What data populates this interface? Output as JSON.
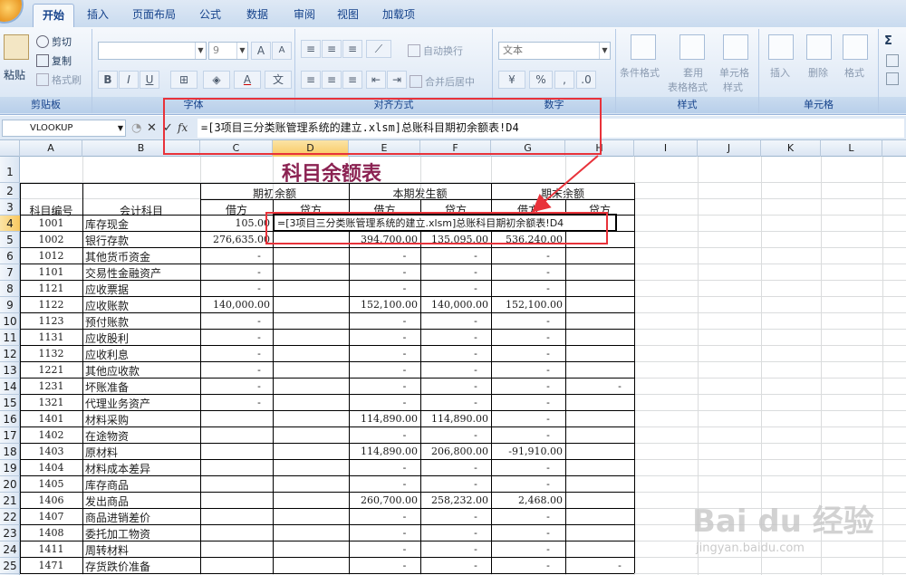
{
  "ribbon_tabs": [
    "开始",
    "插入",
    "页面布局",
    "公式",
    "数据",
    "审阅",
    "视图",
    "加载项"
  ],
  "clipboard": {
    "paste": "粘贴",
    "cut": "剪切",
    "copy": "复制",
    "format_painter": "格式刷",
    "label": "剪贴板"
  },
  "font": {
    "name": "",
    "size": "9",
    "grow": "A",
    "shrink": "A",
    "bold": "B",
    "italic": "I",
    "underline": "U",
    "font_color": "A",
    "phonetic": "文",
    "label": "字体"
  },
  "alignment": {
    "wrap_text": "自动换行",
    "merge_center": "合并后居中",
    "label": "对齐方式"
  },
  "number": {
    "format": "文本",
    "percent": "%",
    "comma": ",",
    "label": "数字"
  },
  "styles": {
    "conditional": "条件格式",
    "table_format_1": "套用",
    "table_format_2": "表格格式",
    "cell_styles_1": "单元格",
    "cell_styles_2": "样式",
    "label": "样式"
  },
  "cells": {
    "insert": "插入",
    "delete": "删除",
    "format": "格式",
    "label": "单元格"
  },
  "editing": {
    "sigma": "Σ"
  },
  "formula_bar": {
    "name_box": "VLOOKUP",
    "fx": "fx",
    "content": "=[3项目三分类账管理系统的建立.xlsm]总账科目期初余额表!D4"
  },
  "columns": [
    "A",
    "B",
    "C",
    "D",
    "E",
    "F",
    "G",
    "H",
    "I",
    "J",
    "K",
    "L"
  ],
  "sheet": {
    "title": "科目余额表",
    "hdr_code": "科目编号",
    "hdr_account": "会计科目",
    "grp_opening": "期初余额",
    "grp_current": "本期发生额",
    "grp_closing": "期末余额",
    "debit": "借方",
    "credit": "贷方",
    "editing_formula": "=[3项目三分类账管理系统的建立.xlsm]总账科目期初余额表!D4",
    "rows": [
      {
        "n": "4",
        "code": "1001",
        "name": "库存现金",
        "c": "105.00",
        "e": "",
        "f": "",
        "g": "",
        "h": ""
      },
      {
        "n": "5",
        "code": "1002",
        "name": "银行存款",
        "c": "276,635.00",
        "e": "394,700.00",
        "f": "135,095.00",
        "g": "536,240.00",
        "h": ""
      },
      {
        "n": "6",
        "code": "1012",
        "name": "其他货币资金",
        "c": "-",
        "e": "-",
        "f": "-",
        "g": "-",
        "h": ""
      },
      {
        "n": "7",
        "code": "1101",
        "name": "交易性金融资产",
        "c": "-",
        "e": "-",
        "f": "-",
        "g": "-",
        "h": ""
      },
      {
        "n": "8",
        "code": "1121",
        "name": "应收票据",
        "c": "-",
        "e": "-",
        "f": "-",
        "g": "-",
        "h": ""
      },
      {
        "n": "9",
        "code": "1122",
        "name": "应收账款",
        "c": "140,000.00",
        "e": "152,100.00",
        "f": "140,000.00",
        "g": "152,100.00",
        "h": ""
      },
      {
        "n": "10",
        "code": "1123",
        "name": "预付账款",
        "c": "-",
        "e": "-",
        "f": "-",
        "g": "-",
        "h": ""
      },
      {
        "n": "11",
        "code": "1131",
        "name": "应收股利",
        "c": "-",
        "e": "-",
        "f": "-",
        "g": "-",
        "h": ""
      },
      {
        "n": "12",
        "code": "1132",
        "name": "应收利息",
        "c": "-",
        "e": "-",
        "f": "-",
        "g": "-",
        "h": ""
      },
      {
        "n": "13",
        "code": "1221",
        "name": "其他应收款",
        "c": "-",
        "e": "-",
        "f": "-",
        "g": "-",
        "h": ""
      },
      {
        "n": "14",
        "code": "1231",
        "name": "坏账准备",
        "c": "-",
        "e": "-",
        "f": "-",
        "g": "-",
        "h": "-"
      },
      {
        "n": "15",
        "code": "1321",
        "name": "代理业务资产",
        "c": "-",
        "e": "-",
        "f": "-",
        "g": "-",
        "h": ""
      },
      {
        "n": "16",
        "code": "1401",
        "name": "材料采购",
        "c": "",
        "e": "114,890.00",
        "f": "114,890.00",
        "g": "-",
        "h": ""
      },
      {
        "n": "17",
        "code": "1402",
        "name": "在途物资",
        "c": "",
        "e": "-",
        "f": "-",
        "g": "-",
        "h": ""
      },
      {
        "n": "18",
        "code": "1403",
        "name": "原材料",
        "c": "",
        "e": "114,890.00",
        "f": "206,800.00",
        "g": "-91,910.00",
        "h": ""
      },
      {
        "n": "19",
        "code": "1404",
        "name": "材料成本差异",
        "c": "",
        "e": "-",
        "f": "-",
        "g": "-",
        "h": ""
      },
      {
        "n": "20",
        "code": "1405",
        "name": "库存商品",
        "c": "",
        "e": "-",
        "f": "-",
        "g": "-",
        "h": ""
      },
      {
        "n": "21",
        "code": "1406",
        "name": "发出商品",
        "c": "",
        "e": "260,700.00",
        "f": "258,232.00",
        "g": "2,468.00",
        "h": ""
      },
      {
        "n": "22",
        "code": "1407",
        "name": "商品进销差价",
        "c": "",
        "e": "-",
        "f": "-",
        "g": "-",
        "h": ""
      },
      {
        "n": "23",
        "code": "1408",
        "name": "委托加工物资",
        "c": "",
        "e": "-",
        "f": "-",
        "g": "-",
        "h": ""
      },
      {
        "n": "24",
        "code": "1411",
        "name": "周转材料",
        "c": "",
        "e": "-",
        "f": "-",
        "g": "-",
        "h": ""
      },
      {
        "n": "25",
        "code": "1471",
        "name": "存货跌价准备",
        "c": "",
        "e": "-",
        "f": "-",
        "g": "-",
        "h": "-"
      }
    ]
  },
  "watermark": {
    "brand": "Bai du 经验",
    "url": "jingyan.baidu.com"
  },
  "colors": {
    "annotation_red": "#e8323a",
    "title_color": "#8b2252",
    "ribbon_text": "#15428b"
  }
}
